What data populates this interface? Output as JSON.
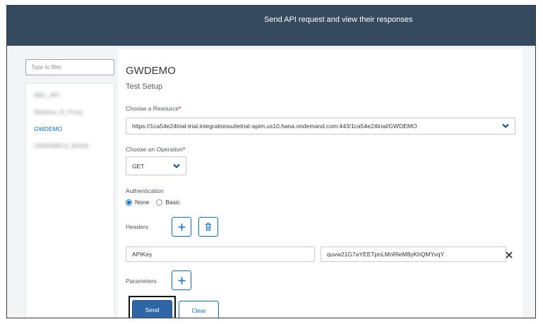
{
  "header": {
    "title": "Send API request and view their responses"
  },
  "sidebar": {
    "filter_placeholder": "Type to filter",
    "items": [
      {
        "label": "ABC_API",
        "redacted": true
      },
      {
        "label": "Weather_R_Proxy",
        "redacted": true
      },
      {
        "label": "GWDEMO",
        "redacted": false,
        "selected": true
      },
      {
        "label": "GWSAMPLE_BASIC",
        "redacted": true
      }
    ]
  },
  "main": {
    "api_name": "GWDEMO",
    "section_title": "Test Setup",
    "resource": {
      "label": "Choose a Resource",
      "required_mark": "*",
      "value": "https://1ca54e24trial-trial.integrationsuitetrial-apim.us10.hana.ondemand.com:443/1ca54e24trial/GWDEMO"
    },
    "operation": {
      "label": "Choose an Operation",
      "required_mark": "*",
      "value": "GET"
    },
    "authentication": {
      "label": "Authentication",
      "options": [
        "None",
        "Basic"
      ],
      "selected": "None"
    },
    "headers": {
      "label": "Headers",
      "rows": [
        {
          "key": "APIKey",
          "value": "quvw21G7aYEETpnLMnRleM8yKhQMYvqY"
        }
      ]
    },
    "parameters": {
      "label": "Parameters"
    },
    "buttons": {
      "send": "Send",
      "clear": "Clear"
    }
  },
  "colors": {
    "header_bg": "#354a5f",
    "accent": "#0a6ed1",
    "send_bg": "#2f66a8",
    "required": "#bb0000"
  },
  "icons": [
    "plus-icon",
    "trash-icon",
    "chevron-down-icon",
    "close-icon"
  ]
}
